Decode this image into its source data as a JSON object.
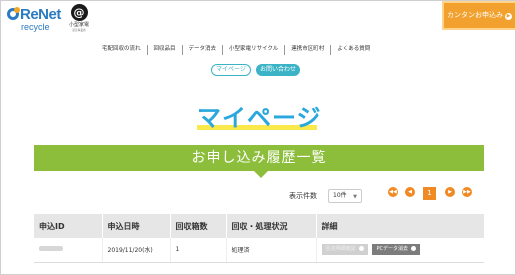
{
  "header": {
    "logo_text": "ReNet",
    "logo_sub": "recycle",
    "cert_mark": "@",
    "cert_text": "小型家電",
    "cert_sub": "認定事業者",
    "cta_label": "カンタンお申込み"
  },
  "nav": {
    "items": [
      "宅配回収の流れ",
      "回収品目",
      "データ消去",
      "小型家電リサイクル",
      "連携市区町村",
      "よくある質問"
    ]
  },
  "pills": {
    "mypage": "マイページ",
    "contact": "お問い合わせ"
  },
  "page_title": "マイページ",
  "section_title": "お申し込み履歴一覧",
  "pager": {
    "count_label": "表示件数",
    "count_value": "10件",
    "current_page": "1"
  },
  "table": {
    "headers": [
      "申込ID",
      "申込日時",
      "回収箱数",
      "回収・処理状況",
      "詳細"
    ],
    "rows": [
      {
        "date": "2019/11/20(水)",
        "boxes": "1",
        "status": "処理済",
        "btn1": "回収明細確認",
        "btn2": "PCデータ消去"
      }
    ]
  },
  "colors": {
    "accent_orange": "#f2a12e",
    "green_band": "#8cbe3c",
    "title_blue": "#2aa7dd",
    "teal": "#3bb3c6"
  }
}
